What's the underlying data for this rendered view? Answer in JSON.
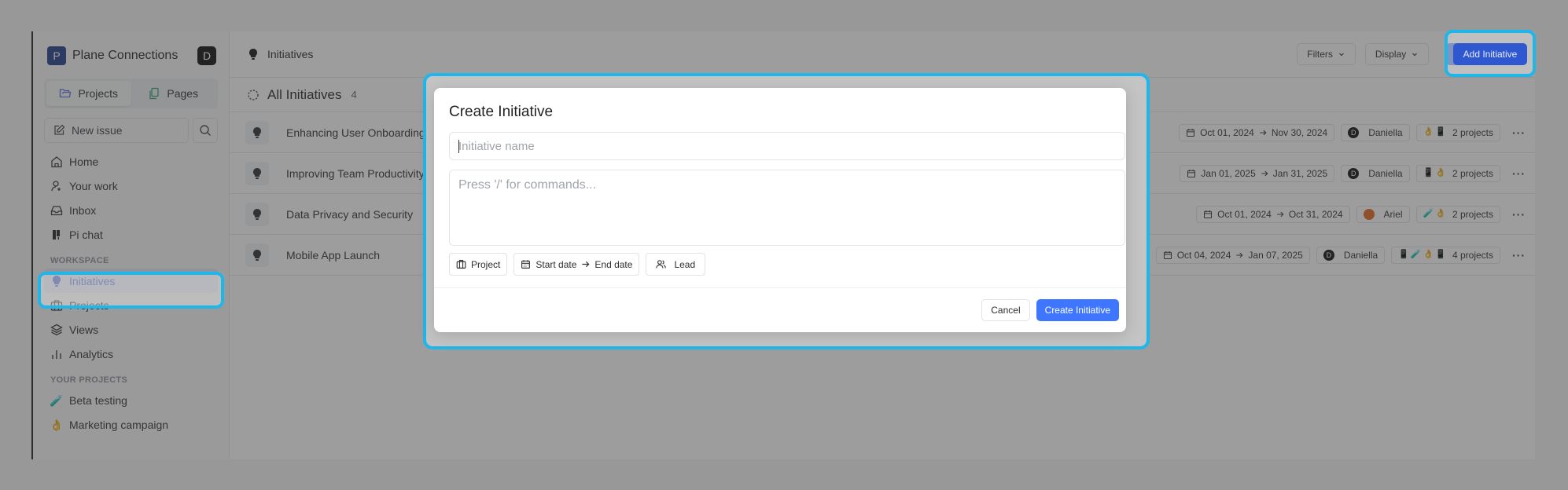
{
  "workspace": {
    "logo_letter": "P",
    "name": "Plane Connections",
    "user_initial": "D"
  },
  "sidebar": {
    "segments": [
      {
        "label": "Projects",
        "icon": "folder-icon",
        "active": true
      },
      {
        "label": "Pages",
        "icon": "pages-icon",
        "active": false
      }
    ],
    "new_issue_label": "New issue",
    "main_nav": [
      {
        "label": "Home",
        "icon": "home-icon"
      },
      {
        "label": "Your work",
        "icon": "user-icon"
      },
      {
        "label": "Inbox",
        "icon": "inbox-icon"
      },
      {
        "label": "Pi chat",
        "icon": "pi-chat-icon"
      }
    ],
    "workspace_label": "WORKSPACE",
    "workspace_nav": [
      {
        "label": "Initiatives",
        "icon": "bulb-icon",
        "active": true
      },
      {
        "label": "Projects",
        "icon": "briefcase-icon"
      },
      {
        "label": "Views",
        "icon": "layers-icon"
      },
      {
        "label": "Analytics",
        "icon": "chart-icon"
      }
    ],
    "projects_label": "YOUR PROJECTS",
    "projects": [
      {
        "label": "Beta testing",
        "emoji": "🧪"
      },
      {
        "label": "Marketing campaign",
        "emoji": "👌"
      }
    ]
  },
  "header": {
    "breadcrumb": "Initiatives",
    "filters_label": "Filters",
    "display_label": "Display",
    "add_label": "Add  Initiative"
  },
  "list": {
    "title": "All Initiatives",
    "count": "4",
    "rows": [
      {
        "name": "Enhancing User Onboarding",
        "start": "Oct 01, 2024",
        "end": "Nov 30, 2024",
        "lead": "Daniella",
        "lead_initial": "D",
        "lead_color": "#0a0a0a",
        "project_emojis": "👌📱",
        "projects": "2 projects"
      },
      {
        "name": "Improving Team Productivity",
        "start": "Jan 01, 2025",
        "end": "Jan 31, 2025",
        "lead": "Daniella",
        "lead_initial": "D",
        "lead_color": "#0a0a0a",
        "project_emojis": "📱👌",
        "projects": "2 projects"
      },
      {
        "name": "Data Privacy and Security",
        "start": "Oct 01, 2024",
        "end": "Oct 31, 2024",
        "lead": "Ariel",
        "lead_initial": "",
        "lead_color": "#e0671a",
        "project_emojis": "🧪👌",
        "projects": "2 projects"
      },
      {
        "name": "Mobile App Launch",
        "start": "Oct 04, 2024",
        "end": "Jan 07, 2025",
        "lead": "Daniella",
        "lead_initial": "D",
        "lead_color": "#0a0a0a",
        "project_emojis": "📱🧪👌📱",
        "projects": "4 projects"
      }
    ]
  },
  "modal": {
    "title": "Create Initiative",
    "name_placeholder": "Initiative name",
    "name_value": "",
    "description_placeholder": "Press '/' for commands...",
    "project_label": "Project",
    "start_date_label": "Start date",
    "end_date_label": "End date",
    "lead_label": "Lead",
    "cancel_label": "Cancel",
    "submit_label": "Create Initiative"
  },
  "colors": {
    "primary": "#3f76ff",
    "highlight": "#1fb6ea",
    "active_nav": "#3f5bd6"
  }
}
